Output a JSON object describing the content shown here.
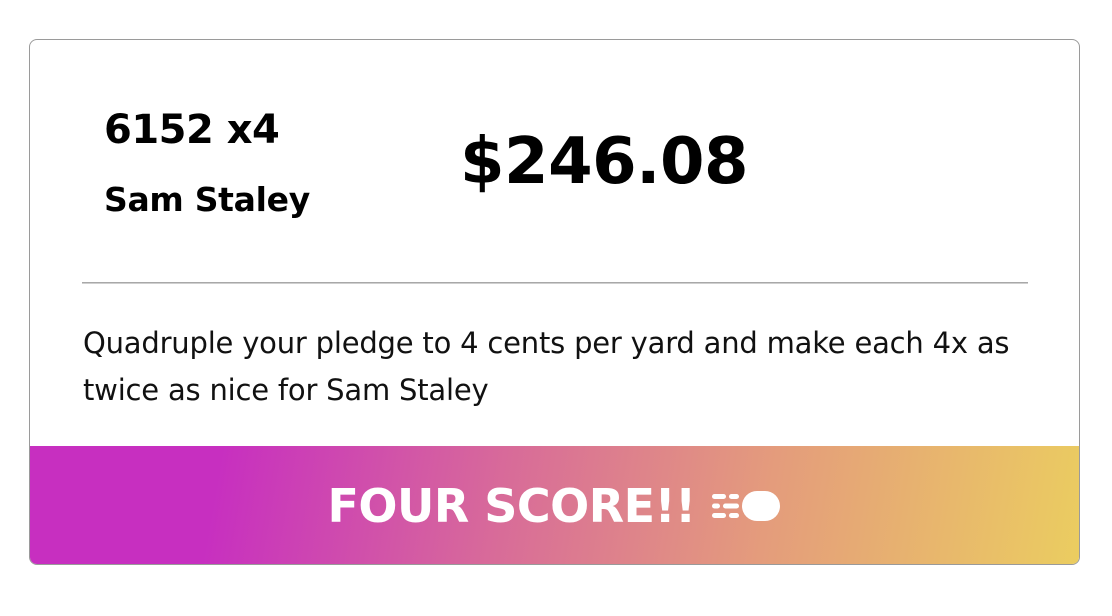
{
  "card": {
    "yardage_text": "6152 x4",
    "player_name": "Sam Staley",
    "amount": "$246.08",
    "description": "Quadruple your pledge to 4 cents per yard and make each 4x as twice as nice for Sam Staley",
    "cta": {
      "label": "FOUR SCORE!!",
      "icon": "football-speed-icon"
    }
  },
  "colors": {
    "text": "#000000",
    "button_text": "#ffffff",
    "gradient": [
      "#c72fc0",
      "#d86b99",
      "#e49c7c",
      "#ebcd60"
    ],
    "border": "#9a9a9a",
    "divider": "#a8a8a8"
  }
}
